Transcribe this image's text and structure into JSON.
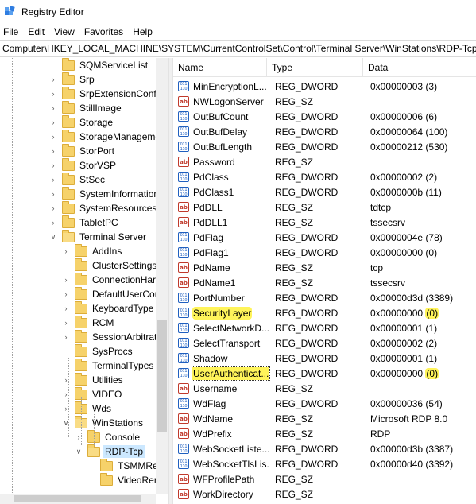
{
  "window": {
    "title": "Registry Editor"
  },
  "menu": [
    "File",
    "Edit",
    "View",
    "Favorites",
    "Help"
  ],
  "address": "Computer\\HKEY_LOCAL_MACHINE\\SYSTEM\\CurrentControlSet\\Control\\Terminal Server\\WinStations\\RDP-Tcp",
  "tree": {
    "items": [
      {
        "label": "SQMServiceList",
        "level": 0,
        "expander": "none"
      },
      {
        "label": "Srp",
        "level": 0,
        "expander": "right"
      },
      {
        "label": "SrpExtensionConfi",
        "level": 0,
        "expander": "right"
      },
      {
        "label": "StillImage",
        "level": 0,
        "expander": "right"
      },
      {
        "label": "Storage",
        "level": 0,
        "expander": "right"
      },
      {
        "label": "StorageManageme",
        "level": 0,
        "expander": "right"
      },
      {
        "label": "StorPort",
        "level": 0,
        "expander": "right"
      },
      {
        "label": "StorVSP",
        "level": 0,
        "expander": "right"
      },
      {
        "label": "StSec",
        "level": 0,
        "expander": "right"
      },
      {
        "label": "SystemInformation",
        "level": 0,
        "expander": "right"
      },
      {
        "label": "SystemResources",
        "level": 0,
        "expander": "right"
      },
      {
        "label": "TabletPC",
        "level": 0,
        "expander": "right"
      },
      {
        "label": "Terminal Server",
        "level": 0,
        "expander": "down"
      },
      {
        "label": "AddIns",
        "level": 1,
        "expander": "right"
      },
      {
        "label": "ClusterSettings",
        "level": 1,
        "expander": "none"
      },
      {
        "label": "ConnectionHar",
        "level": 1,
        "expander": "right"
      },
      {
        "label": "DefaultUserCon",
        "level": 1,
        "expander": "right"
      },
      {
        "label": "KeyboardType M",
        "level": 1,
        "expander": "right"
      },
      {
        "label": "RCM",
        "level": 1,
        "expander": "right"
      },
      {
        "label": "SessionArbitrati",
        "level": 1,
        "expander": "right"
      },
      {
        "label": "SysProcs",
        "level": 1,
        "expander": "none"
      },
      {
        "label": "TerminalTypes",
        "level": 1,
        "expander": "none"
      },
      {
        "label": "Utilities",
        "level": 1,
        "expander": "right"
      },
      {
        "label": "VIDEO",
        "level": 1,
        "expander": "right"
      },
      {
        "label": "Wds",
        "level": 1,
        "expander": "right"
      },
      {
        "label": "WinStations",
        "level": 1,
        "expander": "down"
      },
      {
        "label": "Console",
        "level": 2,
        "expander": "right"
      },
      {
        "label": "RDP-Tcp",
        "level": 2,
        "expander": "down",
        "selected": true
      },
      {
        "label": "TSMMRe",
        "level": 3,
        "expander": "none"
      },
      {
        "label": "VideoRen",
        "level": 3,
        "expander": "none"
      }
    ]
  },
  "list": {
    "headers": {
      "name": "Name",
      "type": "Type",
      "data": "Data"
    },
    "rows": [
      {
        "name": "MinEncryptionL...",
        "type": "REG_DWORD",
        "data": "0x00000003 (3)",
        "kind": "dword"
      },
      {
        "name": "NWLogonServer",
        "type": "REG_SZ",
        "data": "",
        "kind": "sz"
      },
      {
        "name": "OutBufCount",
        "type": "REG_DWORD",
        "data": "0x00000006 (6)",
        "kind": "dword"
      },
      {
        "name": "OutBufDelay",
        "type": "REG_DWORD",
        "data": "0x00000064 (100)",
        "kind": "dword"
      },
      {
        "name": "OutBufLength",
        "type": "REG_DWORD",
        "data": "0x00000212 (530)",
        "kind": "dword"
      },
      {
        "name": "Password",
        "type": "REG_SZ",
        "data": "",
        "kind": "sz"
      },
      {
        "name": "PdClass",
        "type": "REG_DWORD",
        "data": "0x00000002 (2)",
        "kind": "dword"
      },
      {
        "name": "PdClass1",
        "type": "REG_DWORD",
        "data": "0x0000000b (11)",
        "kind": "dword"
      },
      {
        "name": "PdDLL",
        "type": "REG_SZ",
        "data": "tdtcp",
        "kind": "sz"
      },
      {
        "name": "PdDLL1",
        "type": "REG_SZ",
        "data": "tssecsrv",
        "kind": "sz"
      },
      {
        "name": "PdFlag",
        "type": "REG_DWORD",
        "data": "0x0000004e (78)",
        "kind": "dword"
      },
      {
        "name": "PdFlag1",
        "type": "REG_DWORD",
        "data": "0x00000000 (0)",
        "kind": "dword"
      },
      {
        "name": "PdName",
        "type": "REG_SZ",
        "data": "tcp",
        "kind": "sz"
      },
      {
        "name": "PdName1",
        "type": "REG_SZ",
        "data": "tssecsrv",
        "kind": "sz"
      },
      {
        "name": "PortNumber",
        "type": "REG_DWORD",
        "data": "0x00000d3d (3389)",
        "kind": "dword"
      },
      {
        "name": "SecurityLayer",
        "type": "REG_DWORD",
        "data": "0x00000000 (0)",
        "kind": "dword",
        "highlight": true
      },
      {
        "name": "SelectNetworkD...",
        "type": "REG_DWORD",
        "data": "0x00000001 (1)",
        "kind": "dword"
      },
      {
        "name": "SelectTransport",
        "type": "REG_DWORD",
        "data": "0x00000002 (2)",
        "kind": "dword"
      },
      {
        "name": "Shadow",
        "type": "REG_DWORD",
        "data": "0x00000001 (1)",
        "kind": "dword"
      },
      {
        "name": "UserAuthenticat...",
        "type": "REG_DWORD",
        "data": "0x00000000 (0)",
        "kind": "dword",
        "highlight": true,
        "selected": true
      },
      {
        "name": "Username",
        "type": "REG_SZ",
        "data": "",
        "kind": "sz"
      },
      {
        "name": "WdFlag",
        "type": "REG_DWORD",
        "data": "0x00000036 (54)",
        "kind": "dword"
      },
      {
        "name": "WdName",
        "type": "REG_SZ",
        "data": "Microsoft RDP 8.0",
        "kind": "sz"
      },
      {
        "name": "WdPrefix",
        "type": "REG_SZ",
        "data": "RDP",
        "kind": "sz"
      },
      {
        "name": "WebSocketListe...",
        "type": "REG_DWORD",
        "data": "0x00000d3b (3387)",
        "kind": "dword"
      },
      {
        "name": "WebSocketTlsLis...",
        "type": "REG_DWORD",
        "data": "0x00000d40 (3392)",
        "kind": "dword"
      },
      {
        "name": "WFProfilePath",
        "type": "REG_SZ",
        "data": "",
        "kind": "sz"
      },
      {
        "name": "WorkDirectory",
        "type": "REG_SZ",
        "data": "",
        "kind": "sz"
      }
    ]
  },
  "colors": {
    "highlight": "#fff45a",
    "selection": "#cce8ff",
    "string_icon": "#c0392b",
    "dword_icon": "#1f5fbf"
  }
}
